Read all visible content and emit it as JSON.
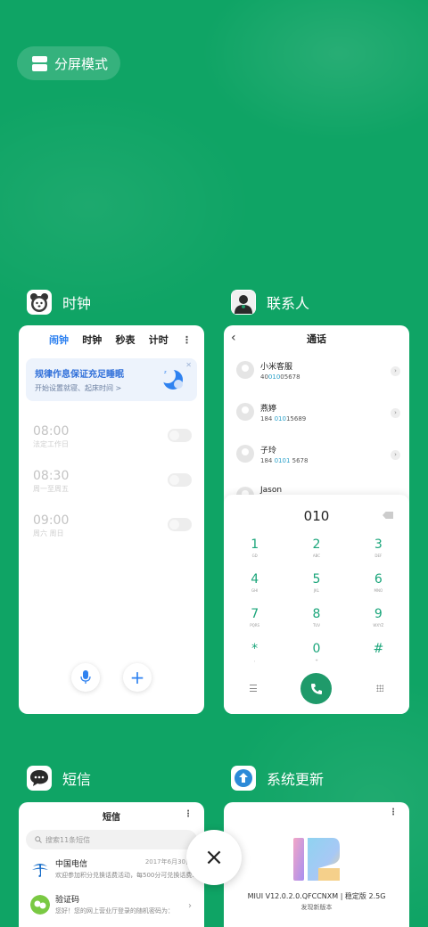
{
  "split_mode": {
    "label": "分屏模式",
    "icon": "split-screen-icon"
  },
  "apps": {
    "clock": {
      "name": "时钟",
      "icon": "clock-app-icon",
      "tabs": [
        "闹钟",
        "时钟",
        "秒表",
        "计时"
      ],
      "active_tab": "闹钟",
      "banner": {
        "title": "规律作息保证充足睡眠",
        "subtitle": "开始设置就寝、起床时间 >"
      },
      "alarms": [
        {
          "time": "08:00",
          "desc": "法定工作日",
          "enabled": false
        },
        {
          "time": "08:30",
          "desc": "周一至周五",
          "enabled": false
        },
        {
          "time": "09:00",
          "desc": "周六 周日",
          "enabled": false
        }
      ],
      "mic_icon": "mic-icon",
      "add_icon": "plus-icon"
    },
    "contacts": {
      "name": "联系人",
      "icon": "contacts-app-icon",
      "title": "通话",
      "contacts": [
        {
          "name": "小米客服",
          "num_pre": "40",
          "num_hi": "010",
          "num_post": "05678"
        },
        {
          "name": "燕婷",
          "num_pre": "184 ",
          "num_hi": "010",
          "num_post": "15689"
        },
        {
          "name": "子玲",
          "num_pre": "184 ",
          "num_hi": "0101",
          "num_post": " 5678"
        },
        {
          "name": "Jason",
          "num_pre": "",
          "num_hi": "",
          "num_post": ""
        }
      ],
      "dialed": "010",
      "keys": [
        {
          "d": "1",
          "l": "GD"
        },
        {
          "d": "2",
          "l": "ABC"
        },
        {
          "d": "3",
          "l": "DEF"
        },
        {
          "d": "4",
          "l": "GHI"
        },
        {
          "d": "5",
          "l": "JKL"
        },
        {
          "d": "6",
          "l": "MNO"
        },
        {
          "d": "7",
          "l": "PQRS"
        },
        {
          "d": "8",
          "l": "TUV"
        },
        {
          "d": "9",
          "l": "WXYZ"
        },
        {
          "d": "*",
          "l": ","
        },
        {
          "d": "0",
          "l": "+"
        },
        {
          "d": "#",
          "l": ""
        }
      ]
    },
    "sms": {
      "name": "短信",
      "icon": "sms-app-icon",
      "title": "短信",
      "search_placeholder": "搜索11条短信",
      "messages": [
        {
          "sender": "中国电信",
          "date": "2017年6月30日",
          "text": "欢迎参加积分兑换话费活动，每500分可兑换话费5元，兑换话费请回复106或jfdh#话费金..."
        },
        {
          "sender": "验证码",
          "date": "",
          "text": "您好！您的网上营业厅登录的随机密码为："
        }
      ]
    },
    "update": {
      "name": "系统更新",
      "icon": "system-update-app-icon",
      "version": "MIUI V12.0.2.0.QFCCNXM | 稳定版 2.5G",
      "subtitle": "发现新版本"
    }
  },
  "close_all": {
    "label": "×",
    "icon": "close-icon"
  },
  "colors": {
    "background": "#0fa465",
    "accent_blue": "#2f82f0",
    "dial_green": "#1aa57a"
  }
}
